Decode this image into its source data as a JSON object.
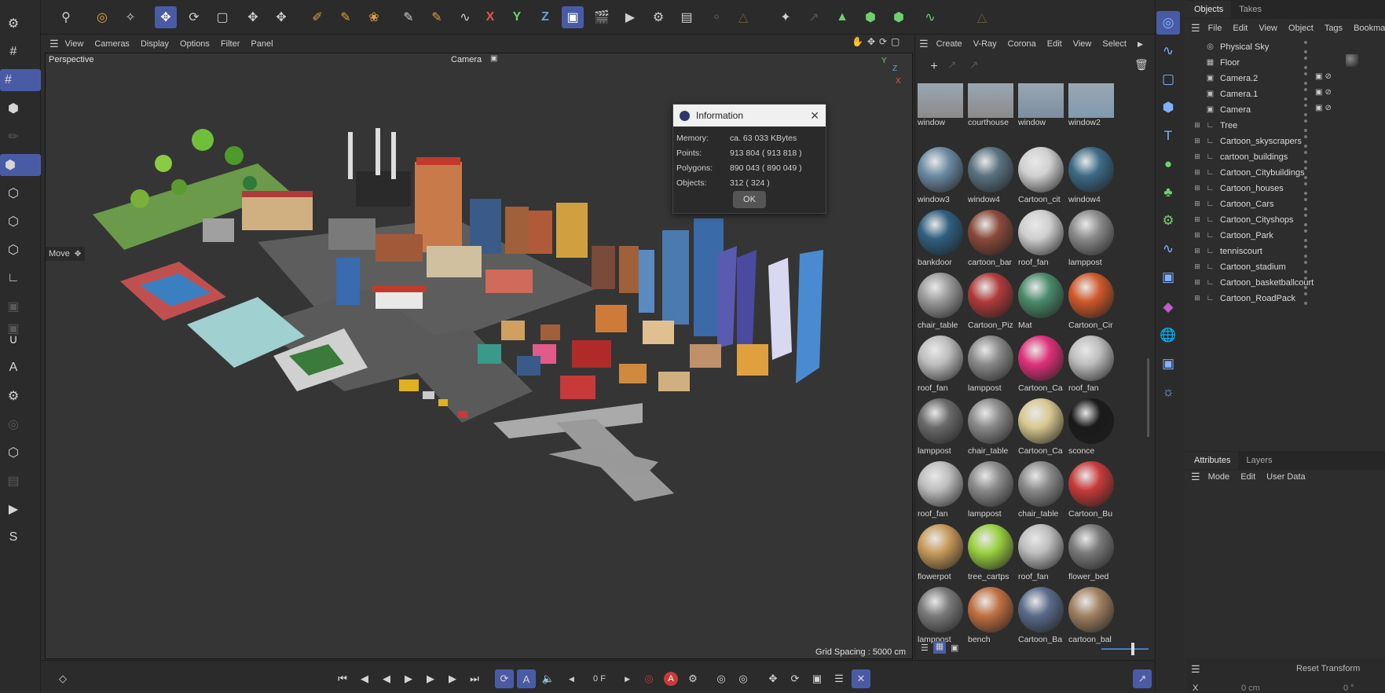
{
  "viewport_menu": [
    "View",
    "Cameras",
    "Display",
    "Options",
    "Filter",
    "Panel"
  ],
  "viewport": {
    "name": "Perspective",
    "camera": "Camera",
    "move_label": "Move",
    "grid_spacing": "Grid Spacing : 5000 cm"
  },
  "material_menu": [
    "Create",
    "V-Ray",
    "Corona",
    "Edit",
    "View",
    "Select"
  ],
  "dialog": {
    "title": "Information",
    "rows": [
      {
        "label": "Memory:",
        "value": "ca. 63 033 KBytes"
      },
      {
        "label": "Points:",
        "value": "913 804 ( 913 818 )"
      },
      {
        "label": "Polygons:",
        "value": "890 043 ( 890 049 )"
      },
      {
        "label": "Objects:",
        "value": "312 ( 324 )"
      }
    ],
    "ok": "OK"
  },
  "materials": [
    "window",
    "courthouse",
    "window",
    "window2",
    "window3",
    "window4",
    "Cartoon_cit",
    "window4",
    "bankdoor",
    "cartoon_bar",
    "roof_fan",
    "lamppost",
    "chair_table",
    "Cartoon_Piz",
    "Mat",
    "Cartoon_Cir",
    "roof_fan",
    "lamppost",
    "Cartoon_Ca",
    "roof_fan",
    "lamppost",
    "chair_table",
    "Cartoon_Ca",
    "sconce",
    "roof_fan",
    "lamppost",
    "chair_table",
    "Cartoon_Bu",
    "flowerpot",
    "tree_cartps",
    "roof_fan",
    "flower_bed",
    "lamppost",
    "bench",
    "Cartoon_Ba",
    "cartoon_bal"
  ],
  "material_colors": [
    "#8a8a8a",
    "#8a8a8a",
    "#7b8ea0",
    "#7f9ab0",
    "#6b8aa3",
    "#5a7280",
    "#d0d0d0",
    "#3c6a86",
    "#2f5f80",
    "#8a4a3a",
    "#cfcfcf",
    "#8a8a8a",
    "#9a9a9a",
    "#b03a3a",
    "#4a8a6a",
    "#d0582a",
    "#bdbdbd",
    "#8a8a8a",
    "#e0307a",
    "#bdbdbd",
    "#6a6a6a",
    "#8a8a8a",
    "#d8c890",
    "#1a1a1a",
    "#bdbdbd",
    "#8a8a8a",
    "#8a8a8a",
    "#c83a3a",
    "#c89a5a",
    "#9ad040",
    "#bdbdbd",
    "#7a7a7a",
    "#7a7a7a",
    "#c07040",
    "#5a6a8a",
    "#a08060"
  ],
  "objects_tabs": [
    "Objects",
    "Takes"
  ],
  "objects_menu": [
    "File",
    "Edit",
    "View",
    "Object",
    "Tags",
    "Bookmarks"
  ],
  "objects": [
    {
      "name": "Physical Sky",
      "icon": "sky-icon",
      "expand": false
    },
    {
      "name": "Floor",
      "icon": "floor-icon",
      "expand": false
    },
    {
      "name": "Camera.2",
      "icon": "camera-icon",
      "expand": false
    },
    {
      "name": "Camera.1",
      "icon": "camera-icon",
      "expand": false
    },
    {
      "name": "Camera",
      "icon": "camera-icon",
      "expand": false
    },
    {
      "name": "Tree",
      "icon": "null-icon",
      "expand": true
    },
    {
      "name": "Cartoon_skyscrapers",
      "icon": "null-icon",
      "expand": true
    },
    {
      "name": "cartoon_buildings",
      "icon": "null-icon",
      "expand": true
    },
    {
      "name": "Cartoon_Citybuildings",
      "icon": "null-icon",
      "expand": true
    },
    {
      "name": "Cartoon_houses",
      "icon": "null-icon",
      "expand": true
    },
    {
      "name": "Cartoon_Cars",
      "icon": "null-icon",
      "expand": true
    },
    {
      "name": "Cartoon_Cityshops",
      "icon": "null-icon",
      "expand": true
    },
    {
      "name": "Cartoon_Park",
      "icon": "null-icon",
      "expand": true
    },
    {
      "name": "tenniscourt",
      "icon": "null-icon",
      "expand": true
    },
    {
      "name": "Cartoon_stadium",
      "icon": "null-icon",
      "expand": true
    },
    {
      "name": "Cartoon_basketballcourt",
      "icon": "null-icon",
      "expand": true
    },
    {
      "name": "Cartoon_RoadPack",
      "icon": "null-icon",
      "expand": true
    }
  ],
  "attributes_tabs": [
    "Attributes",
    "Layers"
  ],
  "attributes_menu": [
    "Mode",
    "Edit",
    "User Data"
  ],
  "reset_transform": "Reset Transform",
  "coord": {
    "axis": "X",
    "value": "0 cm",
    "angle": "0 °"
  },
  "frame": "0 F",
  "accent": "#4a5ba6"
}
